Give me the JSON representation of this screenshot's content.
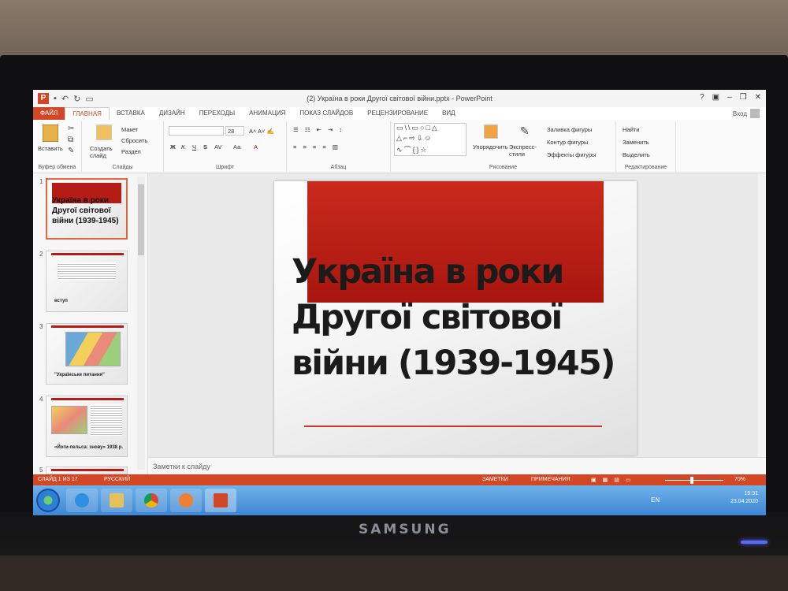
{
  "monitor": {
    "brand": "SAMSUNG"
  },
  "app": {
    "window_title": "(2) Україна в роки Другої світової війни.pptx - PowerPoint",
    "sign_in": "Вход",
    "win_buttons": [
      "?",
      "▣",
      "–",
      "❐",
      "✕"
    ]
  },
  "tabs": [
    "ФАЙЛ",
    "ГЛАВНАЯ",
    "ВСТАВКА",
    "ДИЗАЙН",
    "ПЕРЕХОДЫ",
    "АНИМАЦИЯ",
    "ПОКАЗ СЛАЙДОВ",
    "РЕЦЕНЗИРОВАНИЕ",
    "ВИД"
  ],
  "ribbon": {
    "clipboard": {
      "paste": "Вставить",
      "label": "Буфер обмена"
    },
    "slides": {
      "new_slide": "Создать слайд",
      "layout": "Макет",
      "reset": "Сбросить",
      "section": "Раздел",
      "label": "Слайды"
    },
    "font": {
      "size": "28",
      "bold": "Ж",
      "italic": "К",
      "underline": "Ч",
      "strike": "S",
      "spacing": "AV",
      "case": "Аа",
      "color": "А",
      "label": "Шрифт"
    },
    "paragraph": {
      "label": "Абзац"
    },
    "drawing": {
      "arrange": "Упорядочить",
      "quick_styles": "Экспресс-стили",
      "fill": "Заливка фигуры",
      "outline": "Контур фигуры",
      "effects": "Эффекты фигуры",
      "label": "Рисование"
    },
    "editing": {
      "find": "Найти",
      "replace": "Заменить",
      "select": "Выделить",
      "label": "Редактирование"
    }
  },
  "thumbnails": [
    {
      "num": "1",
      "title": "Україна в роки Другої світової війни (1939-1945)"
    },
    {
      "num": "2",
      "caption": "вступ"
    },
    {
      "num": "3",
      "caption": "\"Українське питання\""
    },
    {
      "num": "4",
      "caption": "«Йоги-пельса: знову» 1938 р."
    },
    {
      "num": "5"
    }
  ],
  "slide": {
    "title": "Україна в роки Другої світової війни (1939-1945)"
  },
  "notes_placeholder": "Заметки к слайду",
  "status": {
    "slide_of": "СЛАЙД 1 ИЗ 17",
    "language": "РУССКИЙ",
    "notes": "ЗАМЕТКИ",
    "comments": "ПРИМЕЧАНИЯ",
    "zoom": "70%"
  },
  "taskbar": {
    "lang": "EN",
    "time": "15:31",
    "date": "23.04.2020"
  }
}
